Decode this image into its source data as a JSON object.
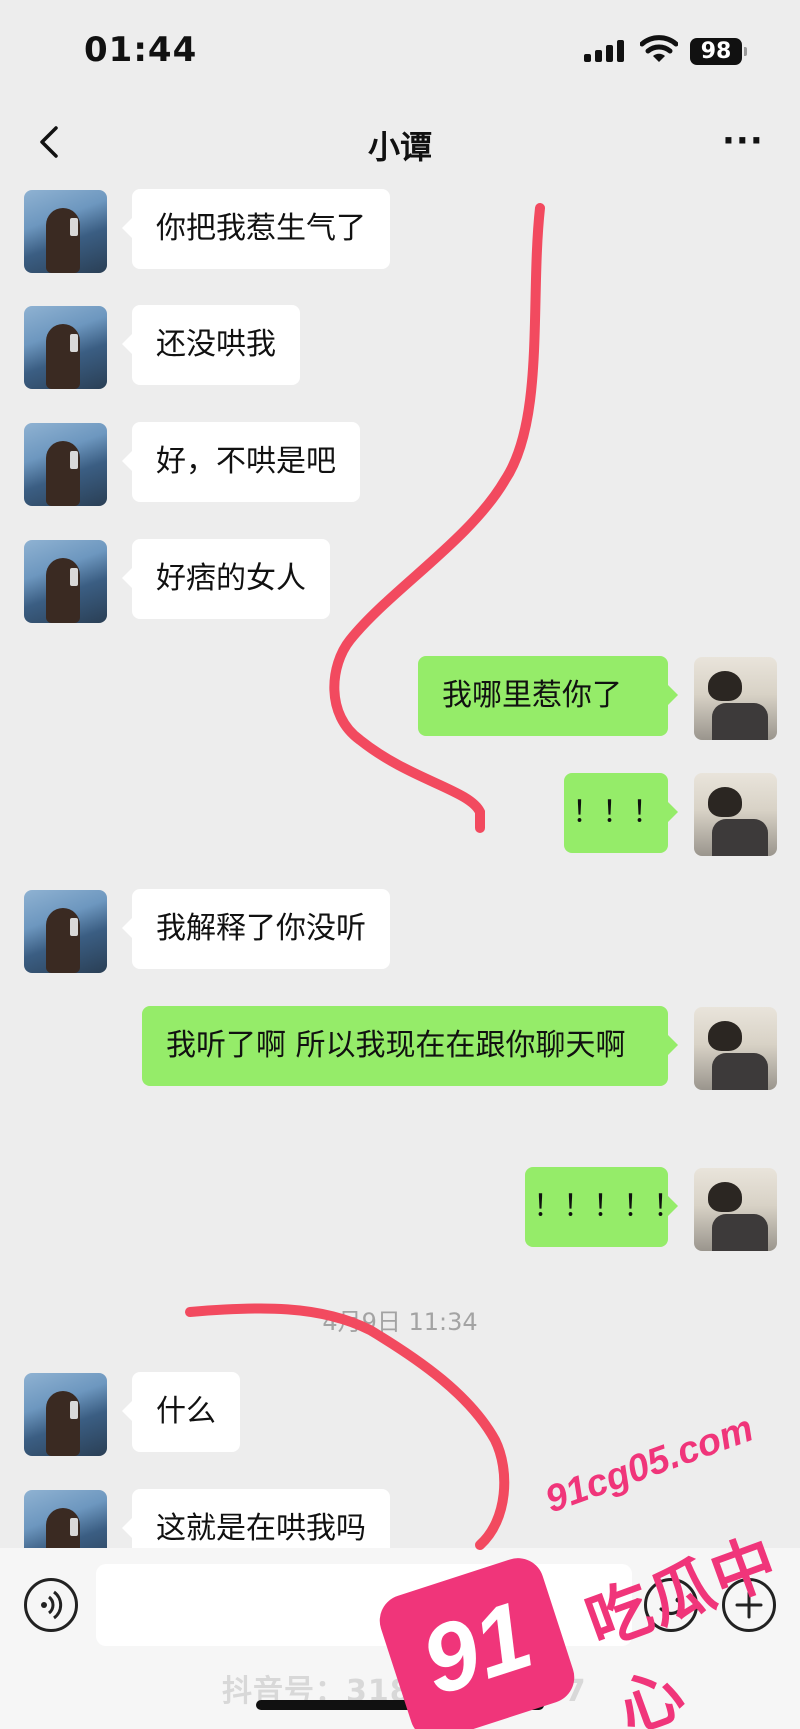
{
  "status_bar": {
    "time": "01:44",
    "battery": "98"
  },
  "header": {
    "title": "小谭",
    "more": "···"
  },
  "messages": [
    {
      "from": "her",
      "text": "你把我惹生气了"
    },
    {
      "from": "her",
      "text": "还没哄我"
    },
    {
      "from": "her",
      "text": "好，不哄是吧"
    },
    {
      "from": "her",
      "text": "好痞的女人"
    },
    {
      "from": "me",
      "text": "我哪里惹你了"
    },
    {
      "from": "me",
      "text": "！！！"
    },
    {
      "from": "her",
      "text": "我解释了你没听"
    },
    {
      "from": "me",
      "text": "我听了啊 所以我现在在跟你聊天啊"
    },
    {
      "from": "me",
      "text": "！！！！！"
    },
    {
      "from": "her",
      "text": "什么"
    },
    {
      "from": "her",
      "text": "这就是在哄我吗"
    }
  ],
  "timestamp": "4月9日 11:34",
  "watermark": {
    "douyin": "抖音号：31801884787"
  },
  "overlay_logo": {
    "number": "91",
    "domain": "91cg05.com",
    "name": "吃瓜中心"
  },
  "colors": {
    "background": "#ededed",
    "incoming_bubble": "#ffffff",
    "outgoing_bubble": "#95ec69",
    "annotation": "#f24a5f",
    "logo": "#f0357a"
  },
  "icons": [
    "back-chevron-icon",
    "more-dots-icon",
    "voice-icon",
    "emoji-icon",
    "plus-icon"
  ]
}
